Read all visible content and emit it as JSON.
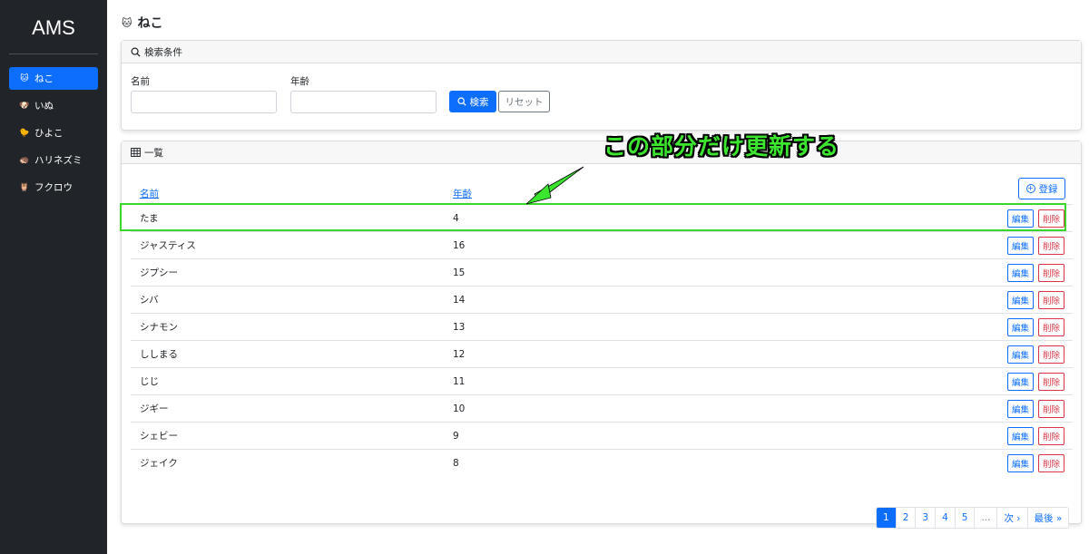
{
  "app": {
    "brand": "AMS"
  },
  "sidebar": {
    "items": [
      {
        "icon": "🐱",
        "label": "ねこ",
        "active": true
      },
      {
        "icon": "🐶",
        "label": "いぬ",
        "active": false
      },
      {
        "icon": "🐤",
        "label": "ひよこ",
        "active": false
      },
      {
        "icon": "🦔",
        "label": "ハリネズミ",
        "active": false
      },
      {
        "icon": "🦉",
        "label": "フクロウ",
        "active": false
      }
    ]
  },
  "page": {
    "icon": "🐱",
    "title": "ねこ"
  },
  "search": {
    "header": "検索条件",
    "name_label": "名前",
    "name_value": "",
    "age_label": "年齢",
    "age_value": "",
    "search_button": "検索",
    "reset_button": "リセット"
  },
  "list": {
    "header": "一覧",
    "col_name": "名前",
    "col_age": "年齢",
    "register_button": "登録",
    "edit_label": "編集",
    "delete_label": "削除",
    "rows": [
      {
        "name": "たま",
        "age": "4"
      },
      {
        "name": "ジャスティス",
        "age": "16"
      },
      {
        "name": "ジプシー",
        "age": "15"
      },
      {
        "name": "シバ",
        "age": "14"
      },
      {
        "name": "シナモン",
        "age": "13"
      },
      {
        "name": "ししまる",
        "age": "12"
      },
      {
        "name": "じじ",
        "age": "11"
      },
      {
        "name": "ジギー",
        "age": "10"
      },
      {
        "name": "シェビー",
        "age": "9"
      },
      {
        "name": "ジェイク",
        "age": "8"
      }
    ]
  },
  "pagination": {
    "pages": [
      "1",
      "2",
      "3",
      "4",
      "5"
    ],
    "ellipsis": "...",
    "next": "次 ›",
    "last": "最後 »",
    "current": "1"
  },
  "annotation": {
    "text": "この部分だけ更新する",
    "color": "#3ce62f"
  }
}
